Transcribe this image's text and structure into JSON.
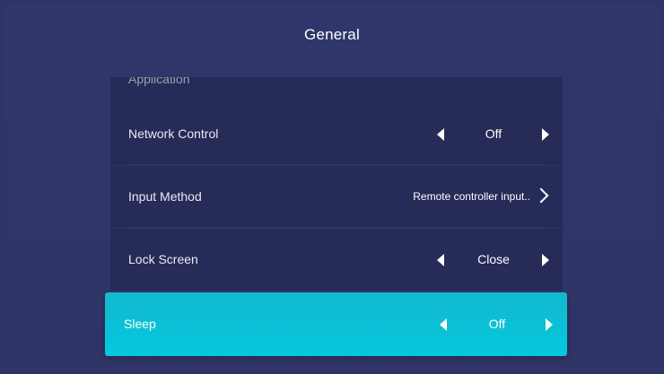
{
  "page": {
    "title": "General"
  },
  "menu": {
    "partial_item": {
      "label": "Application"
    },
    "items": [
      {
        "label": "Network Control",
        "type": "selector",
        "value": "Off"
      },
      {
        "label": "Input Method",
        "type": "submenu",
        "value": "Remote controller input.."
      },
      {
        "label": "Lock Screen",
        "type": "selector",
        "value": "Close"
      }
    ],
    "focused": {
      "label": "Sleep",
      "type": "selector",
      "value": "Off"
    }
  },
  "colors": {
    "background": "#2f3468",
    "row": "#262b57",
    "focus": "#05c8de"
  },
  "icons": {
    "prev": "triangle-left-icon",
    "next": "triangle-right-icon",
    "submenu": "chevron-right-icon"
  }
}
